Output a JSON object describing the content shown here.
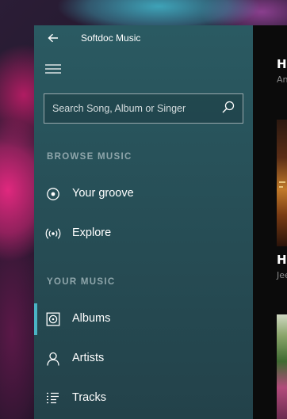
{
  "app": {
    "title": "Softdoc Music"
  },
  "search": {
    "placeholder": "Search Song, Album or Singer",
    "value": ""
  },
  "nav": {
    "browse_header": "BROWSE MUSIC",
    "browse_items": [
      {
        "label": "Your groove",
        "icon": "groove-icon"
      },
      {
        "label": "Explore",
        "icon": "explore-icon"
      }
    ],
    "your_music_header": "YOUR MUSIC",
    "your_music_items": [
      {
        "label": "Albums",
        "icon": "album-icon",
        "selected": true
      },
      {
        "label": "Artists",
        "icon": "person-icon"
      },
      {
        "label": "Tracks",
        "icon": "list-icon"
      }
    ]
  },
  "content": {
    "items": [
      {
        "title": "Ha",
        "subtitle": "An"
      },
      {
        "title": "Ha",
        "subtitle": "Jee"
      }
    ]
  },
  "colors": {
    "accent": "#4ab3c4",
    "nav_background": "#2a5a62",
    "content_background": "#0c0c0c"
  }
}
